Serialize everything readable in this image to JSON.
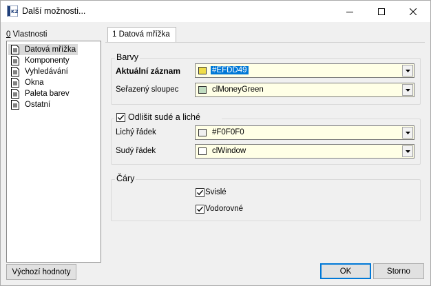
{
  "window": {
    "title": "Další možnosti..."
  },
  "left": {
    "label": "Vlastnosti",
    "label_hotkey": "0",
    "items": [
      {
        "label": "Datová mřížka",
        "selected": true
      },
      {
        "label": "Komponenty"
      },
      {
        "label": "Vyhledávání"
      },
      {
        "label": "Okna"
      },
      {
        "label": "Paleta barev"
      },
      {
        "label": "Ostatní"
      }
    ],
    "defaults_button": "Výchozí hodnoty"
  },
  "tab": {
    "label": "1 Datová mřížka"
  },
  "barvy": {
    "title": "Barvy",
    "current_record": {
      "label": "Aktuální záznam",
      "value": "#EFDD49",
      "color": "#EFDD49"
    },
    "sorted_column": {
      "label": "Seřazený sloupec",
      "value": "clMoneyGreen",
      "color": "#C0DCC0"
    }
  },
  "odd_even": {
    "checkbox_label": "Odlišit sudé a liché",
    "checked": true,
    "odd_row": {
      "label": "Lichý řádek",
      "value": "#F0F0F0",
      "color": "#F0F0F0"
    },
    "even_row": {
      "label": "Sudý řádek",
      "value": "clWindow",
      "color": "#FFFFFF"
    }
  },
  "lines": {
    "title": "Čáry",
    "vertical": {
      "label": "Svislé",
      "checked": true
    },
    "horizontal": {
      "label": "Vodorovné",
      "checked": true
    }
  },
  "footer": {
    "ok": "OK",
    "cancel": "Storno"
  },
  "colors": {
    "accent": "#0078d7",
    "input_bg": "#ffffe6"
  }
}
